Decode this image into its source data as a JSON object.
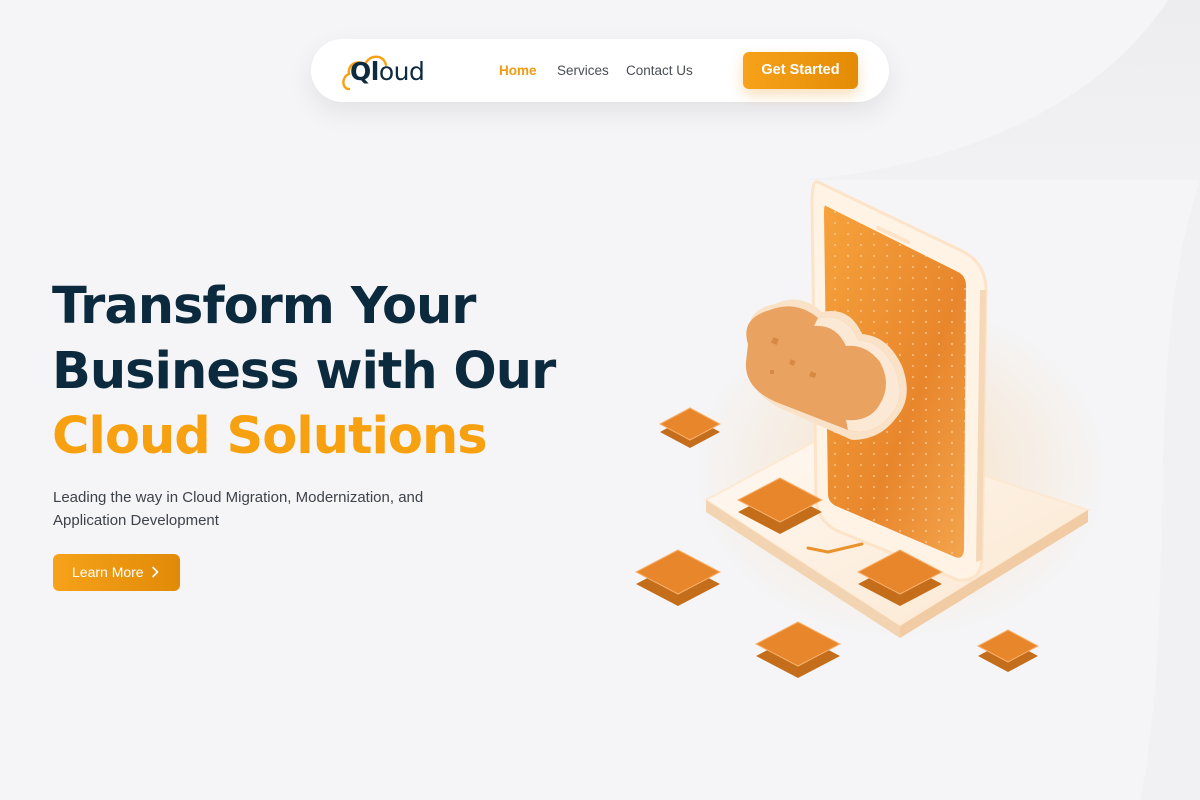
{
  "brand": {
    "logo_q": "Ql",
    "logo_rest": "oud",
    "accent_color": "#f7a010",
    "dark_color": "#0c2a3e"
  },
  "nav": {
    "links": [
      {
        "label": "Home",
        "active": true
      },
      {
        "label": "Services",
        "active": false
      },
      {
        "label": "Contact Us",
        "active": false
      }
    ],
    "cta_label": "Get Started"
  },
  "hero": {
    "title_line1": "Transform Your",
    "title_line2": "Business with Our",
    "title_accent": "Cloud Solutions",
    "subtitle": "Leading the way in Cloud Migration, Modernization, and Application Development",
    "button_label": "Learn More",
    "button_icon": "chevron-right-icon"
  },
  "illustration": {
    "icon": "cloud-server-illustration"
  }
}
